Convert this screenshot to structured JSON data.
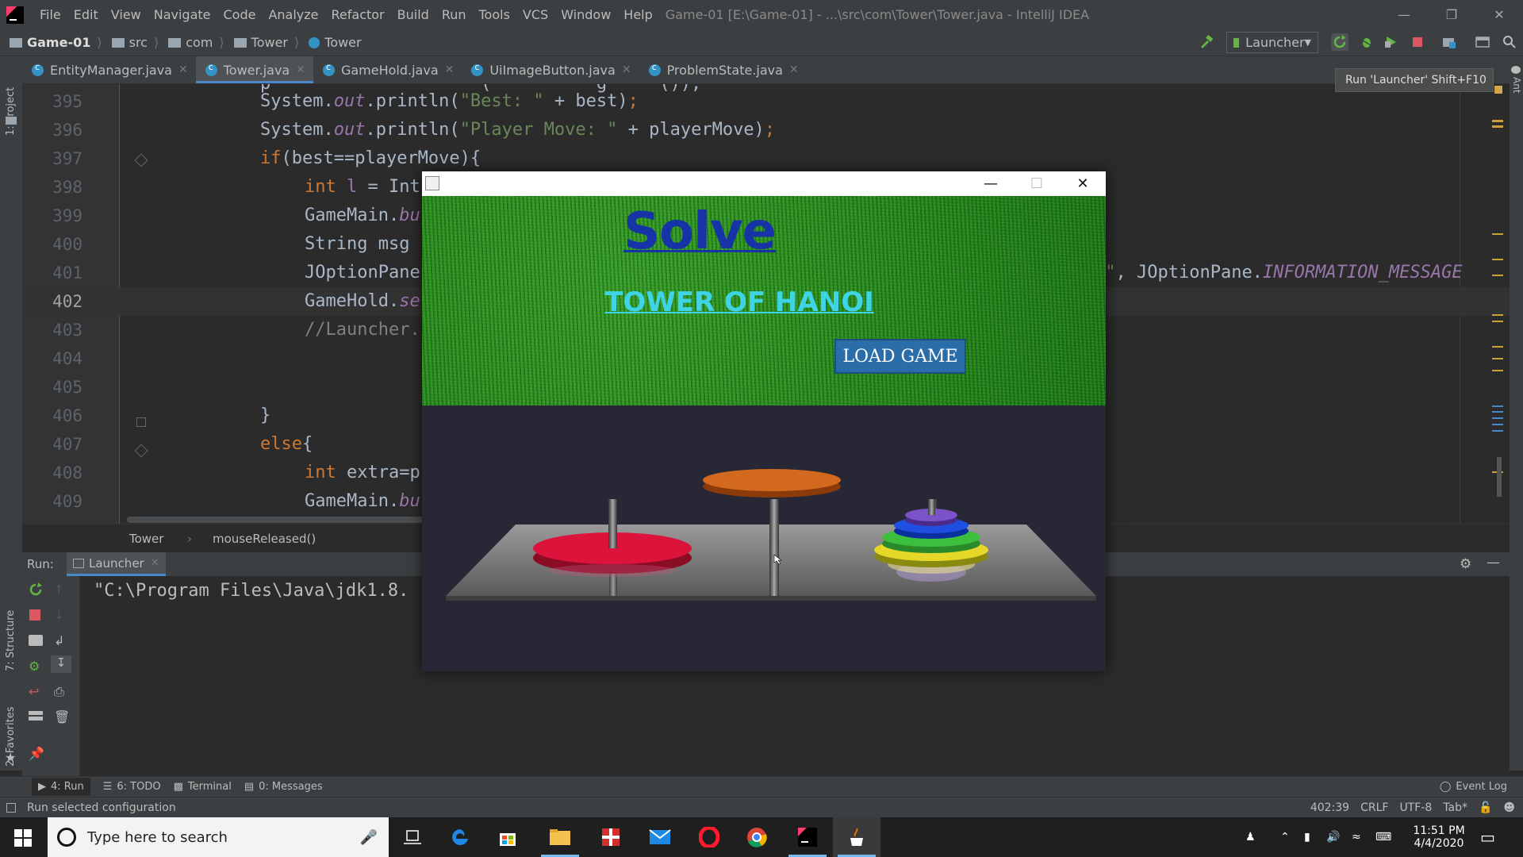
{
  "ide": {
    "menu": [
      "File",
      "Edit",
      "View",
      "Navigate",
      "Code",
      "Analyze",
      "Refactor",
      "Build",
      "Run",
      "Tools",
      "VCS",
      "Window",
      "Help"
    ],
    "window_title": "Game-01 [E:\\Game-01] - ...\\src\\com\\Tower\\Tower.java - IntelliJ IDEA",
    "breadcrumbs": [
      "Game-01",
      "src",
      "com",
      "Tower",
      "Tower"
    ],
    "run_config": "Launcher",
    "tooltip": "Run 'Launcher'  Shift+F10",
    "tabs": [
      {
        "label": "EntityManager.java",
        "active": false
      },
      {
        "label": "Tower.java",
        "active": true
      },
      {
        "label": "GameHold.java",
        "active": false
      },
      {
        "label": "UiImageButton.java",
        "active": false
      },
      {
        "label": "ProblemState.java",
        "active": false
      }
    ],
    "left_panels": {
      "project": "1: Project",
      "structure": "7: Structure",
      "favorites": "2: Favorites"
    },
    "right_panel": "Ant",
    "code_lines": [
      {
        "num": "395",
        "text": "System.out.println(\"Best: \" + best);"
      },
      {
        "num": "396",
        "text": "System.out.println(\"Player Move: \" + playerMove);"
      },
      {
        "num": "397",
        "text": "if(best==playerMove){"
      },
      {
        "num": "398",
        "text": "int l = Int"
      },
      {
        "num": "399",
        "text": "GameMain.bu"
      },
      {
        "num": "400",
        "text": "String msg"
      },
      {
        "num": "401",
        "text": "JOptionPane",
        "tail": "i\", JOptionPane.INFORMATION_MESSAGE"
      },
      {
        "num": "402",
        "text": "GameHold.se"
      },
      {
        "num": "403",
        "text": "//Launcher."
      },
      {
        "num": "404",
        "text": ""
      },
      {
        "num": "405",
        "text": ""
      },
      {
        "num": "406",
        "text": "}"
      },
      {
        "num": "407",
        "text": "else{"
      },
      {
        "num": "408",
        "text": "int extra=p"
      },
      {
        "num": "409",
        "text": "GameMain.bu"
      }
    ],
    "code_crumbs": [
      "Tower",
      "mouseReleased()"
    ],
    "run_label": "Run:",
    "run_tab": "Launcher",
    "console_text": "\"C:\\Program Files\\Java\\jdk1.8.",
    "bottom_tabs": [
      "4: Run",
      "6: TODO",
      "Terminal",
      "0: Messages"
    ],
    "event_log": "Event Log",
    "status_message": "Run selected configuration",
    "status_right": [
      "402:39",
      "CRLF",
      "UTF-8",
      "Tab*"
    ]
  },
  "game": {
    "title": "Solve",
    "subtitle": "TOWER OF HANOI",
    "button": "LOAD GAME"
  },
  "taskbar": {
    "search_placeholder": "Type here to search",
    "time": "11:51 PM",
    "date": "4/4/2020"
  },
  "colors": {
    "accent": "#4a88c7",
    "grass": "#2b8a22",
    "title_blue": "#1633a8",
    "subtitle_cyan": "#3fd3e6",
    "button_blue": "#2b6da8"
  }
}
